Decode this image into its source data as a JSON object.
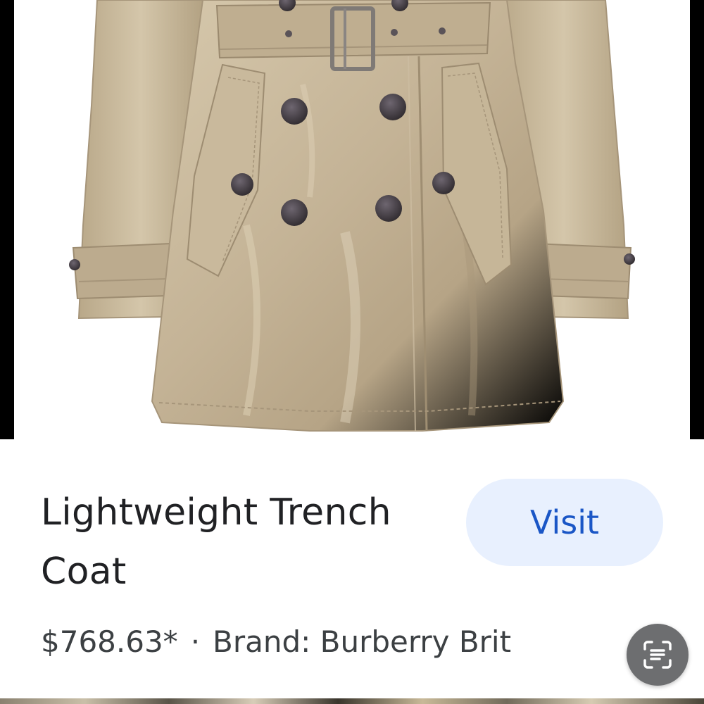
{
  "product": {
    "title": "Lightweight Trench Coat",
    "price": "$768.63*",
    "separator": "·",
    "brand": "Brand: Burberry Brit",
    "image_alt": "Beige lightweight trench coat with belt and dark buttons"
  },
  "actions": {
    "visit_label": "Visit",
    "lens_icon": "lens-scan-icon"
  },
  "colors": {
    "coat": "#c4b396",
    "coat_shadow": "#a8977a",
    "coat_highlight": "#ddd0b8",
    "button": "#4a4448",
    "visit_bg": "#e8f0fe",
    "visit_text": "#1a56c6",
    "fab_bg": "#6d6e70"
  }
}
